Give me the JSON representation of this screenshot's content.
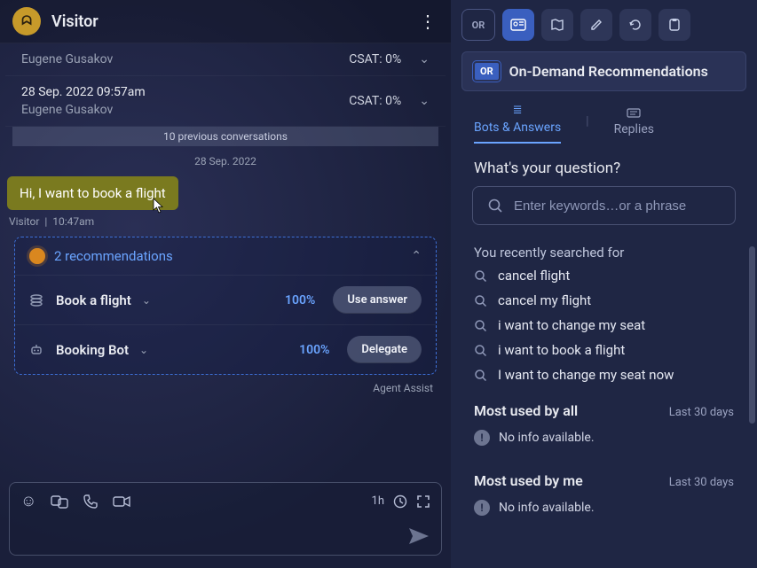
{
  "header": {
    "title": "Visitor",
    "avatar_glyph": "ᗣ"
  },
  "conversations": [
    {
      "timestamp": "",
      "agent": "Eugene Gusakov",
      "csat": "CSAT: 0%"
    },
    {
      "timestamp": "28 Sep. 2022 09:57am",
      "agent": "Eugene Gusakov",
      "csat": "CSAT: 0%"
    }
  ],
  "previous_bar": "10 previous conversations",
  "date_separator": "28 Sep. 2022",
  "message": {
    "text": "Hi, I want to book a flight",
    "sender": "Visitor",
    "separator": "|",
    "time": "10:47am"
  },
  "recommendations": {
    "title": "2 recommendations",
    "items": [
      {
        "name": "Book a flight",
        "pct": "100%",
        "action": "Use answer",
        "icon": "layers"
      },
      {
        "name": "Booking Bot",
        "pct": "100%",
        "action": "Delegate",
        "icon": "bot"
      }
    ],
    "footer": "Agent Assist"
  },
  "composer": {
    "timer": "1h"
  },
  "toolbar": {
    "or": "OR"
  },
  "odr": {
    "badge": "OR",
    "title": "On-Demand Recommendations"
  },
  "tabs": {
    "bots": "Bots & Answers",
    "replies": "Replies"
  },
  "question_label": "What's your question?",
  "search_placeholder": "Enter keywords…or a phrase",
  "recent_label": "You recently searched for",
  "recent": [
    "cancel flight",
    "cancel my flight",
    "i want to change my seat",
    "i want to book a flight",
    "I want to change my seat now"
  ],
  "usage_all": {
    "title": "Most used by all",
    "range": "Last 30 days",
    "empty": "No info available."
  },
  "usage_me": {
    "title": "Most used by me",
    "range": "Last 30 days",
    "empty": "No info available."
  }
}
